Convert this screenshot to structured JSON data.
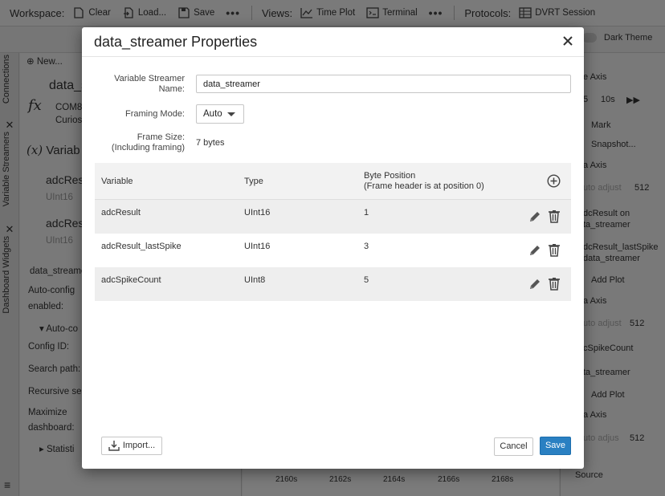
{
  "toolbar": {
    "workspace_label": "Workspace:",
    "clear_label": "Clear",
    "load_label": "Load...",
    "save_label": "Save",
    "views_label": "Views:",
    "time_plot_label": "Time Plot",
    "terminal_label": "Terminal",
    "protocols_label": "Protocols:",
    "dvrt_label": "DVRT Session",
    "dark_theme_label": "Dark Theme"
  },
  "left_rail": {
    "connections_tab": "Connections",
    "variable_streamers_tab": "Variable Streamers",
    "dashboard_widgets_tab": "Dashboard Widgets"
  },
  "left_panel": {
    "new_label": "New...",
    "item_title": "data_s",
    "item_sub1": "COM8",
    "item_sub2": "Curios",
    "var_title": "Variab",
    "var1": "adcRes",
    "var1_type": "UInt16",
    "var2": "adcRes",
    "var2_type": "UInt16",
    "streamer_name": "data_streame",
    "auto_config": "Auto-config",
    "enabled": "enabled:",
    "auto_co": "Auto-co",
    "config_id": "Config ID:",
    "search_path": "Search path:",
    "recursive": "Recursive sea",
    "maximize": "Maximize",
    "dashboard": "dashboard:",
    "statistics": "Statisti"
  },
  "center_panel": {
    "ticks": [
      "2160s",
      "2162s",
      "2164s",
      "2166s",
      "2168s"
    ]
  },
  "right_panel": {
    "axis1": "e Axis",
    "btn_5": "5",
    "btn_10s": "10s",
    "mark": "Mark",
    "snapshot": "Snapshot...",
    "axis2": "a Axis",
    "auto_adjust1": "uto adjust",
    "val1": "512",
    "result_on": "dcResult on",
    "result_on2": "ta_streamer",
    "last_spike": "dcResult_lastSpike",
    "last_spike2": "data_streamer",
    "add_plot1": "Add Plot",
    "axis3": "a Axis",
    "auto_adjust2": "uto adjust",
    "val2": "512",
    "spike_count": "cSpikeCount",
    "spike_count2": "ta_streamer",
    "add_plot2": "Add Plot",
    "axis4": "a Axis",
    "auto_adjust3": "uto adjus",
    "val3": "512",
    "source": "Source"
  },
  "dialog": {
    "title": "data_streamer Properties",
    "name_label_1": "Variable Streamer",
    "name_label_2": "Name:",
    "name_value": "data_streamer",
    "framing_label": "Framing Mode:",
    "framing_value": "Auto",
    "frame_size_label_1": "Frame Size:",
    "frame_size_label_2": "(Including framing)",
    "frame_size_value": "7 bytes",
    "table": {
      "col_variable": "Variable",
      "col_type": "Type",
      "col_byte_1": "Byte Position",
      "col_byte_2": "(Frame header is at position 0)",
      "rows": [
        {
          "variable": "adcResult",
          "type": "UInt16",
          "byte": "1"
        },
        {
          "variable": "adcResult_lastSpike",
          "type": "UInt16",
          "byte": "3"
        },
        {
          "variable": "adcSpikeCount",
          "type": "UInt8",
          "byte": "5"
        }
      ]
    },
    "import_label": "Import...",
    "cancel_label": "Cancel",
    "save_label": "Save"
  },
  "colors": {
    "accent": "#2a80c2",
    "overlay": "rgba(0,0,0,0.5)"
  }
}
